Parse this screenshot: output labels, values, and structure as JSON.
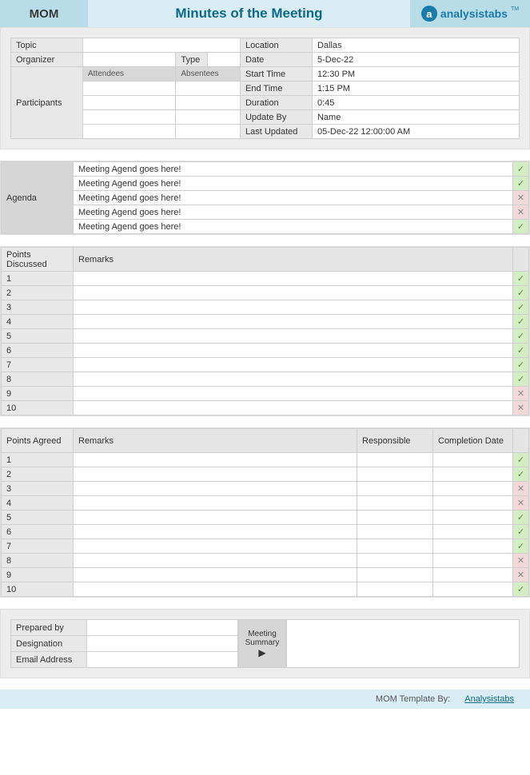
{
  "header": {
    "mom": "MOM",
    "title": "Minutes of the Meeting",
    "logo_text": "analysistabs",
    "logo_tm": "TM"
  },
  "info": {
    "topic_label": "Topic",
    "topic_value": "",
    "organizer_label": "Organizer",
    "organizer_value": "",
    "type_label": "Type",
    "type_value": "",
    "participants_label": "Participants",
    "attendees_label": "Attendees",
    "absentees_label": "Absentees",
    "location_label": "Location",
    "location_value": "Dallas",
    "date_label": "Date",
    "date_value": "5-Dec-22",
    "start_label": "Start Time",
    "start_value": "12:30 PM",
    "end_label": "End Time",
    "end_value": "1:15 PM",
    "duration_label": "Duration",
    "duration_value": "0:45",
    "updateby_label": "Update By",
    "updateby_value": "Name",
    "lastupdated_label": "Last Updated",
    "lastupdated_value": "05-Dec-22 12:00:00 AM"
  },
  "agenda": {
    "label": "Agenda",
    "items": [
      {
        "text": "Meeting Agend goes here!",
        "status": "ok"
      },
      {
        "text": "Meeting Agend goes here!",
        "status": "ok"
      },
      {
        "text": "Meeting Agend goes here!",
        "status": "x"
      },
      {
        "text": "Meeting Agend goes here!",
        "status": "x"
      },
      {
        "text": "Meeting Agend goes here!",
        "status": "ok"
      }
    ]
  },
  "points_discussed": {
    "col1": "Points Discussed",
    "col2": "Remarks",
    "rows": [
      {
        "n": "1",
        "remark": "",
        "status": "ok"
      },
      {
        "n": "2",
        "remark": "",
        "status": "ok"
      },
      {
        "n": "3",
        "remark": "",
        "status": "ok"
      },
      {
        "n": "4",
        "remark": "",
        "status": "ok"
      },
      {
        "n": "5",
        "remark": "",
        "status": "ok"
      },
      {
        "n": "6",
        "remark": "",
        "status": "ok"
      },
      {
        "n": "7",
        "remark": "",
        "status": "ok"
      },
      {
        "n": "8",
        "remark": "",
        "status": "ok"
      },
      {
        "n": "9",
        "remark": "",
        "status": "x"
      },
      {
        "n": "10",
        "remark": "",
        "status": "x"
      }
    ]
  },
  "points_agreed": {
    "col1": "Points Agreed",
    "col2": "Remarks",
    "col3": "Responsible",
    "col4": "Completion Date",
    "rows": [
      {
        "n": "1",
        "remark": "",
        "resp": "",
        "date": "",
        "status": "ok"
      },
      {
        "n": "2",
        "remark": "",
        "resp": "",
        "date": "",
        "status": "ok"
      },
      {
        "n": "3",
        "remark": "",
        "resp": "",
        "date": "",
        "status": "x"
      },
      {
        "n": "4",
        "remark": "",
        "resp": "",
        "date": "",
        "status": "x"
      },
      {
        "n": "5",
        "remark": "",
        "resp": "",
        "date": "",
        "status": "ok"
      },
      {
        "n": "6",
        "remark": "",
        "resp": "",
        "date": "",
        "status": "ok"
      },
      {
        "n": "7",
        "remark": "",
        "resp": "",
        "date": "",
        "status": "ok"
      },
      {
        "n": "8",
        "remark": "",
        "resp": "",
        "date": "",
        "status": "x"
      },
      {
        "n": "9",
        "remark": "",
        "resp": "",
        "date": "",
        "status": "x"
      },
      {
        "n": "10",
        "remark": "",
        "resp": "",
        "date": "",
        "status": "ok"
      }
    ]
  },
  "summary": {
    "prepared_label": "Prepared by",
    "prepared_value": "",
    "designation_label": "Designation",
    "designation_value": "",
    "email_label": "Email Address",
    "email_value": "",
    "meeting": "Meeting",
    "summary_word": "Summary"
  },
  "footer": {
    "by": "MOM Template By:",
    "link": "Analysistabs"
  },
  "glyph": {
    "check": "✓",
    "x": "✕",
    "arrow": "▶"
  }
}
